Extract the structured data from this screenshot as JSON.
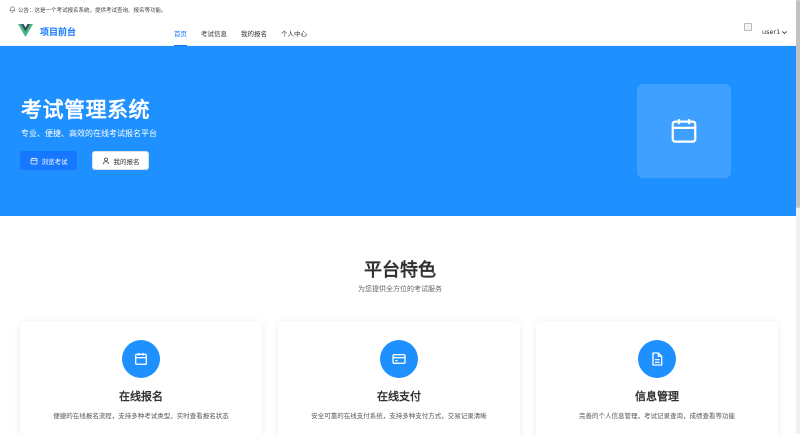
{
  "notice": {
    "text": "公告：这是一个考试报名系统，提供考试查询、报名等功能。"
  },
  "header": {
    "brand": "项目前台",
    "nav": [
      {
        "label": "首页",
        "active": true
      },
      {
        "label": "考试信息",
        "active": false
      },
      {
        "label": "我的报名",
        "active": false
      },
      {
        "label": "个人中心",
        "active": false
      }
    ],
    "username": "user1"
  },
  "hero": {
    "title": "考试管理系统",
    "subtitle": "专业、便捷、高效的在线考试报名平台",
    "primary_button": "浏览考试",
    "secondary_button": "我的报名"
  },
  "features": {
    "title": "平台特色",
    "subtitle": "为您提供全方位的考试服务",
    "cards": [
      {
        "icon": "calendar-icon",
        "title": "在线报名",
        "desc": "便捷的在线报名流程，支持多种考试类型，实时查看报名状态"
      },
      {
        "icon": "wallet-icon",
        "title": "在线支付",
        "desc": "安全可靠的在线支付系统，支持多种支付方式，交易记录清晰"
      },
      {
        "icon": "document-icon",
        "title": "信息管理",
        "desc": "完善的个人信息管理，考试记录查询，成绩查看等功能"
      }
    ]
  },
  "colors": {
    "primary": "#1677ff",
    "hero_bg": "#1e90ff"
  }
}
